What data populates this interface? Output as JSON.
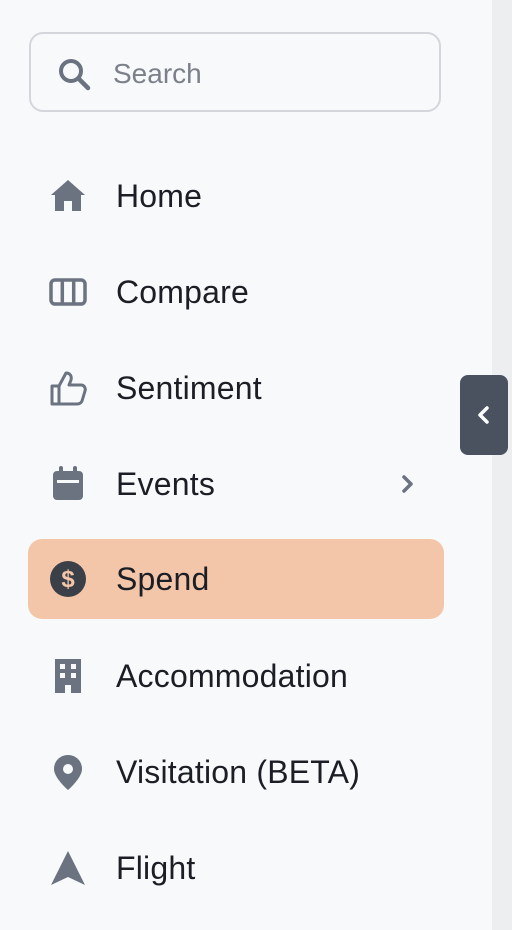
{
  "search": {
    "placeholder": "Search",
    "value": ""
  },
  "nav": {
    "items": [
      {
        "label": "Home",
        "icon": "home-icon",
        "active": false
      },
      {
        "label": "Compare",
        "icon": "columns-icon",
        "active": false
      },
      {
        "label": "Sentiment",
        "icon": "thumbs-up-icon",
        "active": false
      },
      {
        "label": "Events",
        "icon": "calendar-icon",
        "active": false,
        "has_submenu": true
      },
      {
        "label": "Spend",
        "icon": "dollar-circle-icon",
        "active": true
      },
      {
        "label": "Accommodation",
        "icon": "building-icon",
        "active": false
      },
      {
        "label": "Visitation (BETA)",
        "icon": "map-pin-icon",
        "active": false
      },
      {
        "label": "Flight",
        "icon": "navigation-arrow-icon",
        "active": false
      }
    ]
  },
  "collapse_tab": {
    "icon": "chevron-left-icon"
  },
  "colors": {
    "active_bg": "#f3c6aa",
    "icon": "#6b7280",
    "text": "#1b1e24",
    "collapse_tab_bg": "#4a5260"
  }
}
